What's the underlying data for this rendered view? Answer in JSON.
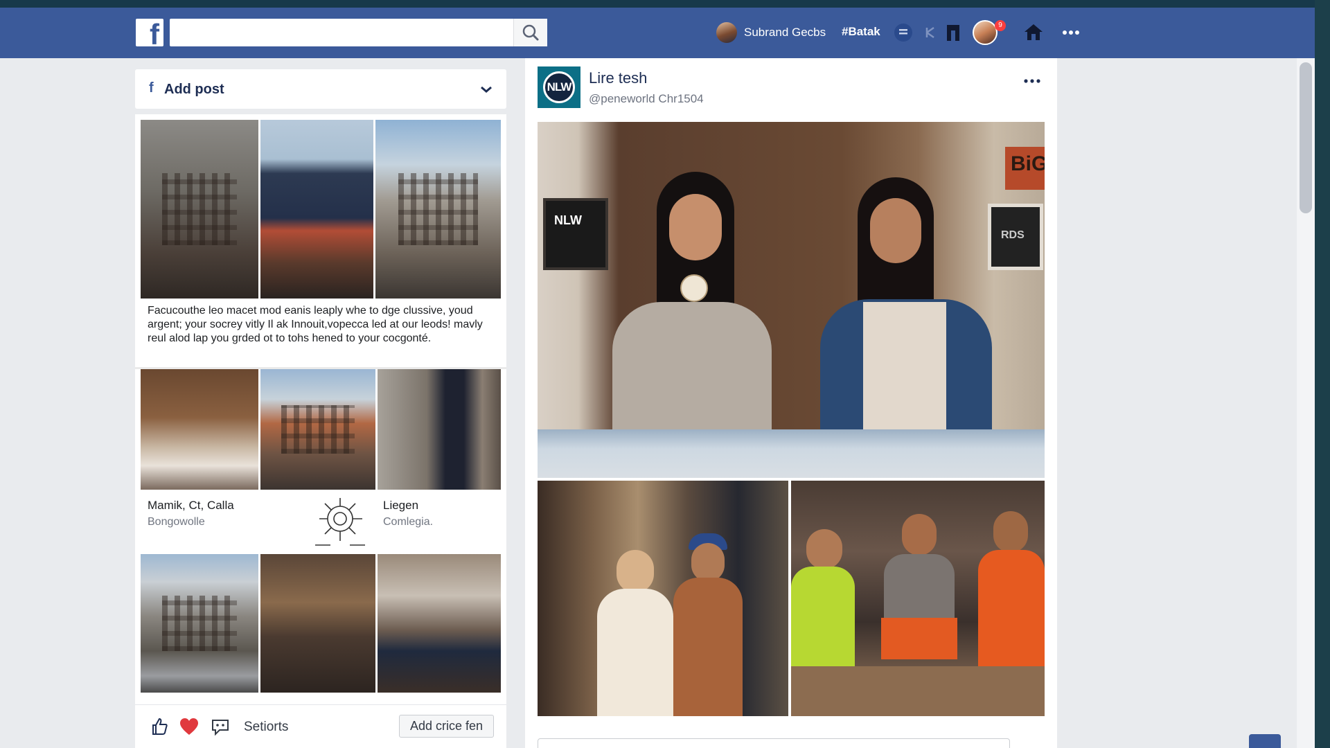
{
  "header": {
    "search": {
      "placeholder": "",
      "value": ""
    },
    "user_name": "Subrand Gecbs",
    "hashtag": "#Batak",
    "notification_count": "9"
  },
  "left": {
    "add_post": {
      "label": "Add post"
    },
    "post_text": "Facucouthe leo macet mod eanis leaply whe to dge clussive, youd argent; your socrey vitly Il ak Innouit,vopecca led at our leods! mavly reul alod lap you grded ot to tohs hened to your cocgonté.",
    "captions": [
      {
        "title": "Mamik, Ct, Calla",
        "sub": "Bongowolle"
      },
      {
        "title": "Liegen",
        "sub": "Comlegia."
      }
    ],
    "actions": {
      "label": "Setiorts",
      "button": "Add crice fen"
    }
  },
  "post": {
    "author": "Lire tesh",
    "handle": "@peneworld Chr1504",
    "avatar_text": "NLW",
    "poster_text": "BiG",
    "frame_text": "RDS"
  },
  "colors": {
    "brand": "#3b5a9a",
    "page_bg": "#e9ebee",
    "notification": "#fa3e3e",
    "heart": "#e0393e"
  },
  "icons": [
    "facebook-logo-icon",
    "search-icon",
    "messenger-icon",
    "friends-icon",
    "bookmark-icon",
    "home-icon",
    "more-icon",
    "chevron-down-icon",
    "like-icon",
    "heart-icon",
    "comment-icon"
  ]
}
